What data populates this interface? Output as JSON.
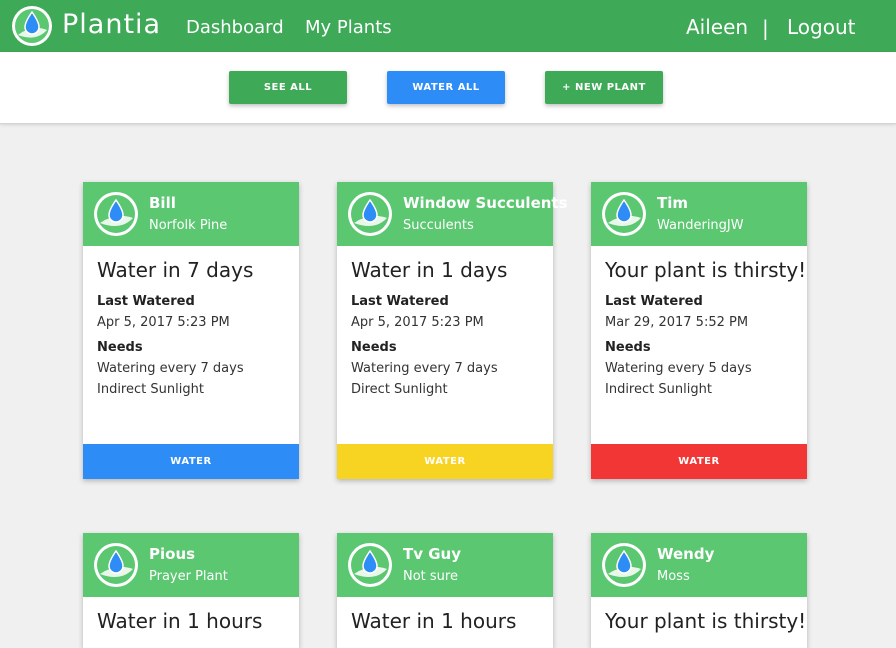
{
  "header": {
    "brand": "Plantia",
    "nav": {
      "dashboard": "Dashboard",
      "my_plants": "My Plants"
    },
    "user": "Aileen",
    "separator": "|",
    "logout": "Logout",
    "logo_icon": "water-drop-leaf-icon"
  },
  "actions": {
    "see_all": "SEE ALL",
    "water_all": "WATER ALL",
    "new_plant": "+ NEW PLANT"
  },
  "labels": {
    "last_watered": "Last Watered",
    "needs": "Needs",
    "water_button": "WATER"
  },
  "colors": {
    "header_green": "#3ea957",
    "card_header_green": "#5bc771",
    "button_blue": "#2d8cf5",
    "button_yellow": "#f7d322",
    "button_red": "#f23535"
  },
  "plants": [
    {
      "name": "Bill",
      "species": "Norfolk Pine",
      "status": "Water in 7 days",
      "last_watered": "Apr 5, 2017 5:23 PM",
      "watering": "Watering every 7 days",
      "sunlight": "Indirect Sunlight",
      "button_color": "#2d8cf5"
    },
    {
      "name": "Window Succulents",
      "species": "Succulents",
      "status": "Water in 1 days",
      "last_watered": "Apr 5, 2017 5:23 PM",
      "watering": "Watering every 7 days",
      "sunlight": "Direct Sunlight",
      "button_color": "#f7d322"
    },
    {
      "name": "Tim",
      "species": "WanderingJW",
      "status": "Your plant is thirsty!",
      "last_watered": "Mar 29, 2017 5:52 PM",
      "watering": "Watering every 5 days",
      "sunlight": "Indirect Sunlight",
      "button_color": "#f23535"
    },
    {
      "name": "Pious",
      "species": "Prayer Plant",
      "status": "Water in 1 hours"
    },
    {
      "name": "Tv Guy",
      "species": "Not sure",
      "status": "Water in 1 hours"
    },
    {
      "name": "Wendy",
      "species": "Moss",
      "status": "Your plant is thirsty!"
    }
  ]
}
